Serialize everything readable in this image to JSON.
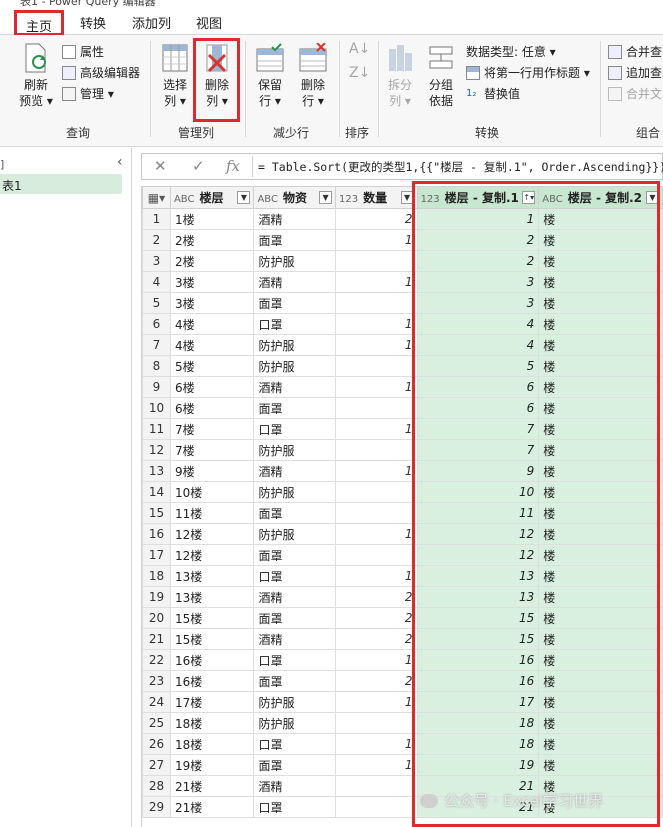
{
  "title": "表1 - Power Query 编辑器",
  "tabs": [
    "主页",
    "转换",
    "添加列",
    "视图"
  ],
  "ribbon": {
    "query": {
      "label": "查询",
      "refresh": "刷新",
      "refresh2": "预览",
      "properties": "属性",
      "advanced": "高级编辑器",
      "manage": "管理"
    },
    "manage_cols": {
      "label": "管理列",
      "choose": "选择",
      "choose2": "列",
      "remove": "删除",
      "remove2": "列"
    },
    "reduce_rows": {
      "label": "减少行",
      "keep": "保留",
      "keep2": "行",
      "remove": "删除",
      "remove2": "行"
    },
    "sort": {
      "label": "排序"
    },
    "transform": {
      "label": "转换",
      "split": "拆分",
      "split2": "列",
      "group": "分组",
      "group2": "依据",
      "datatype": "数据类型: 任意",
      "first_row": "将第一行用作标题",
      "replace": "替换值"
    },
    "combine": {
      "label": "组合",
      "merge": "合并查",
      "append": "追加查",
      "merge_files": "合并文"
    }
  },
  "query_pane": {
    "item": "表1"
  },
  "formula": "= Table.Sort(更改的类型1,{{\"楼层 - 复制.1\", Order.Ascending}})",
  "columns": [
    {
      "type": "ABC",
      "name": "楼层"
    },
    {
      "type": "ABC",
      "name": "物资"
    },
    {
      "type": "123",
      "name": "数量"
    },
    {
      "type": "123",
      "name": "楼层 - 复制.1"
    },
    {
      "type": "ABC",
      "name": "楼层 - 复制.2"
    }
  ],
  "rows": [
    {
      "n": "1",
      "floor": "1楼",
      "item": "酒精",
      "qty": "2",
      "c1": "1",
      "c2": "楼"
    },
    {
      "n": "2",
      "floor": "2楼",
      "item": "面罩",
      "qty": "1",
      "c1": "2",
      "c2": "楼"
    },
    {
      "n": "3",
      "floor": "2楼",
      "item": "防护服",
      "qty": "",
      "c1": "2",
      "c2": "楼"
    },
    {
      "n": "4",
      "floor": "3楼",
      "item": "酒精",
      "qty": "1",
      "c1": "3",
      "c2": "楼"
    },
    {
      "n": "5",
      "floor": "3楼",
      "item": "面罩",
      "qty": "",
      "c1": "3",
      "c2": "楼"
    },
    {
      "n": "6",
      "floor": "4楼",
      "item": "口罩",
      "qty": "1",
      "c1": "4",
      "c2": "楼"
    },
    {
      "n": "7",
      "floor": "4楼",
      "item": "防护服",
      "qty": "1",
      "c1": "4",
      "c2": "楼"
    },
    {
      "n": "8",
      "floor": "5楼",
      "item": "防护服",
      "qty": "",
      "c1": "5",
      "c2": "楼"
    },
    {
      "n": "9",
      "floor": "6楼",
      "item": "酒精",
      "qty": "1",
      "c1": "6",
      "c2": "楼"
    },
    {
      "n": "10",
      "floor": "6楼",
      "item": "面罩",
      "qty": "",
      "c1": "6",
      "c2": "楼"
    },
    {
      "n": "11",
      "floor": "7楼",
      "item": "口罩",
      "qty": "1",
      "c1": "7",
      "c2": "楼"
    },
    {
      "n": "12",
      "floor": "7楼",
      "item": "防护服",
      "qty": "",
      "c1": "7",
      "c2": "楼"
    },
    {
      "n": "13",
      "floor": "9楼",
      "item": "酒精",
      "qty": "1",
      "c1": "9",
      "c2": "楼"
    },
    {
      "n": "14",
      "floor": "10楼",
      "item": "防护服",
      "qty": "",
      "c1": "10",
      "c2": "楼"
    },
    {
      "n": "15",
      "floor": "11楼",
      "item": "面罩",
      "qty": "",
      "c1": "11",
      "c2": "楼"
    },
    {
      "n": "16",
      "floor": "12楼",
      "item": "防护服",
      "qty": "1",
      "c1": "12",
      "c2": "楼"
    },
    {
      "n": "17",
      "floor": "12楼",
      "item": "面罩",
      "qty": "",
      "c1": "12",
      "c2": "楼"
    },
    {
      "n": "18",
      "floor": "13楼",
      "item": "口罩",
      "qty": "1",
      "c1": "13",
      "c2": "楼"
    },
    {
      "n": "19",
      "floor": "13楼",
      "item": "酒精",
      "qty": "2",
      "c1": "13",
      "c2": "楼"
    },
    {
      "n": "20",
      "floor": "15楼",
      "item": "面罩",
      "qty": "2",
      "c1": "15",
      "c2": "楼"
    },
    {
      "n": "21",
      "floor": "15楼",
      "item": "酒精",
      "qty": "2",
      "c1": "15",
      "c2": "楼"
    },
    {
      "n": "22",
      "floor": "16楼",
      "item": "口罩",
      "qty": "1",
      "c1": "16",
      "c2": "楼"
    },
    {
      "n": "23",
      "floor": "16楼",
      "item": "面罩",
      "qty": "2",
      "c1": "16",
      "c2": "楼"
    },
    {
      "n": "24",
      "floor": "17楼",
      "item": "防护服",
      "qty": "1",
      "c1": "17",
      "c2": "楼"
    },
    {
      "n": "25",
      "floor": "18楼",
      "item": "防护服",
      "qty": "",
      "c1": "18",
      "c2": "楼"
    },
    {
      "n": "26",
      "floor": "18楼",
      "item": "口罩",
      "qty": "1",
      "c1": "18",
      "c2": "楼"
    },
    {
      "n": "27",
      "floor": "19楼",
      "item": "面罩",
      "qty": "1",
      "c1": "19",
      "c2": "楼"
    },
    {
      "n": "28",
      "floor": "21楼",
      "item": "酒精",
      "qty": "",
      "c1": "21",
      "c2": "楼"
    },
    {
      "n": "29",
      "floor": "21楼",
      "item": "口罩",
      "qty": "",
      "c1": "21",
      "c2": "楼"
    }
  ],
  "watermark": "公众号 · Excel学习世界",
  "colors": {
    "accent_red": "#e0282e",
    "selected_green": "#d9efdf",
    "header_green": "#c8e7d1"
  }
}
